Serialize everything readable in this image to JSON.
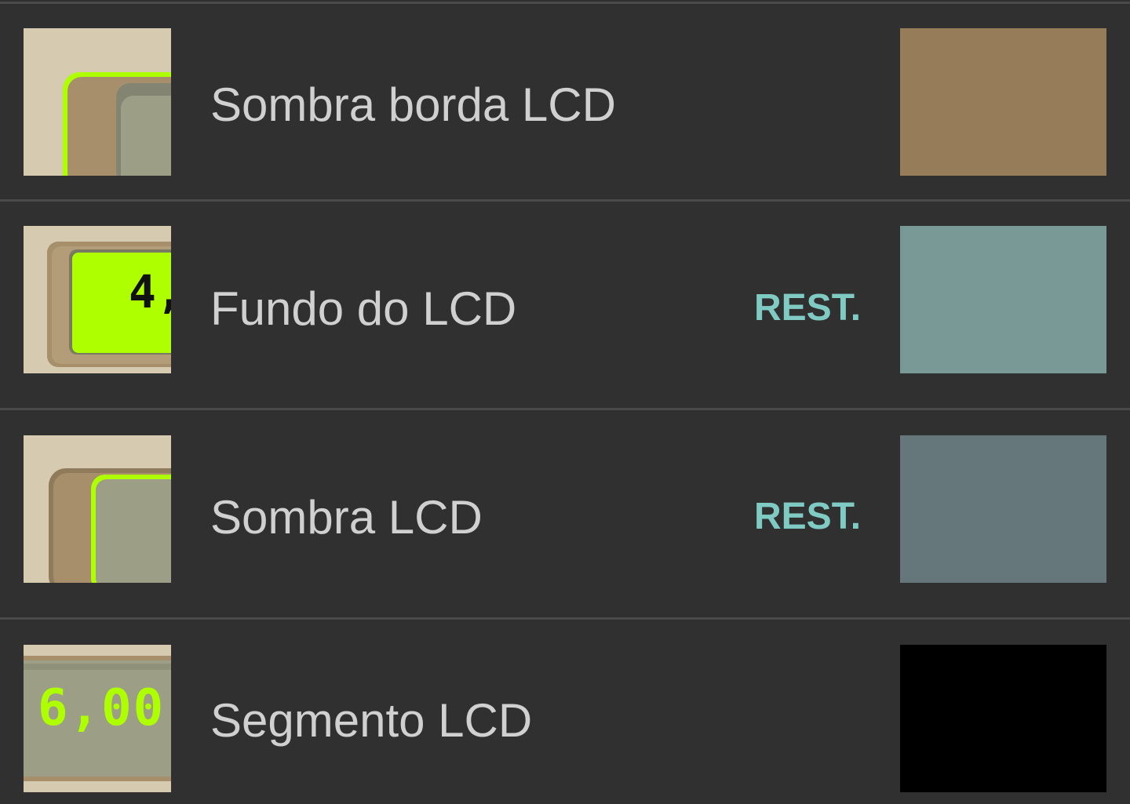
{
  "items": [
    {
      "label": "Sombra borda LCD",
      "reset": "",
      "swatch_color": "#977c5a",
      "thumb_icon": "lcd-border-shadow-preview"
    },
    {
      "label": "Fundo do LCD",
      "reset": "REST.",
      "swatch_color": "#799997",
      "thumb_icon": "lcd-background-preview",
      "preview_text": "4,"
    },
    {
      "label": "Sombra LCD",
      "reset": "REST.",
      "swatch_color": "#66777b",
      "thumb_icon": "lcd-shadow-preview"
    },
    {
      "label": "Segmento LCD",
      "reset": "",
      "swatch_color": "#000000",
      "thumb_icon": "lcd-segment-preview",
      "preview_text": "6,00"
    }
  ],
  "colors": {
    "background": "#303030",
    "divider": "#4a4a4a",
    "label": "#d0d0d0",
    "reset": "#7fcbc4",
    "lcd_green": "#aeff00",
    "bezel_beige": "#d6cbb0",
    "bezel_brown": "#a78f6b",
    "lcd_gray": "#9c9e86"
  }
}
